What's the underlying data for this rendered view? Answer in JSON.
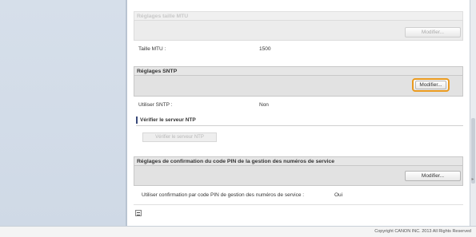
{
  "mtu_section": {
    "title": "Réglages taille MTU",
    "modify_label": "Modifier...",
    "row_label": "Taille MTU :",
    "row_value": "1500"
  },
  "sntp_section": {
    "title": "Réglages SNTP",
    "modify_label": "Modifier...",
    "row_label": "Utiliser SNTP :",
    "row_value": "Non",
    "ntp_heading": "Vérifier le serveur NTP",
    "ntp_button": "Vérifier le serveur NTP"
  },
  "pin_section": {
    "title": "Réglages de confirmation du code PIN de la gestion des numéros de service",
    "modify_label": "Modifier...",
    "row_label": "Utiliser confirmation par code PIN de gestion des numéros de service :",
    "row_value": "Oui"
  },
  "footer": {
    "copyright": "Copyright CANON INC. 2013 All Rights Reserved"
  },
  "icons": {
    "page_top": "page-top-icon",
    "scroll_down": "scroll-down-arrow-icon"
  },
  "colors": {
    "highlight_border": "#ea9a1e",
    "sidebar_bg": "#d6dfea",
    "section_bg": "#e2e2e2"
  }
}
